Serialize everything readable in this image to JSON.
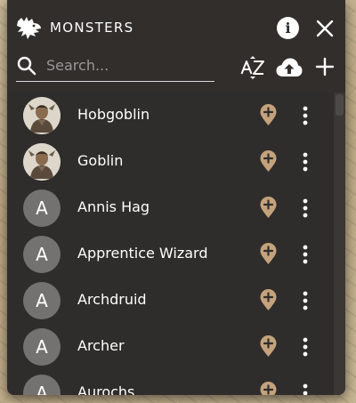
{
  "header": {
    "title": "MONSTERS",
    "info_label": "i"
  },
  "search": {
    "placeholder": "Search...",
    "value": ""
  },
  "toolbar": {
    "sort_icon": "sort-az-icon",
    "upload_icon": "cloud-upload-icon",
    "add_icon": "plus-icon"
  },
  "monsters": [
    {
      "name": "Hobgoblin",
      "avatar": "portrait"
    },
    {
      "name": "Goblin",
      "avatar": "portrait"
    },
    {
      "name": "Annis Hag",
      "avatar": "A"
    },
    {
      "name": "Apprentice Wizard",
      "avatar": "A"
    },
    {
      "name": "Archdruid",
      "avatar": "A"
    },
    {
      "name": "Archer",
      "avatar": "A"
    },
    {
      "name": "Aurochs",
      "avatar": "A"
    }
  ],
  "colors": {
    "panel": "#2f2d2b",
    "pin": "#c4a27c",
    "avatar_bg": "#747270",
    "map_bg": "#c4b08e"
  }
}
